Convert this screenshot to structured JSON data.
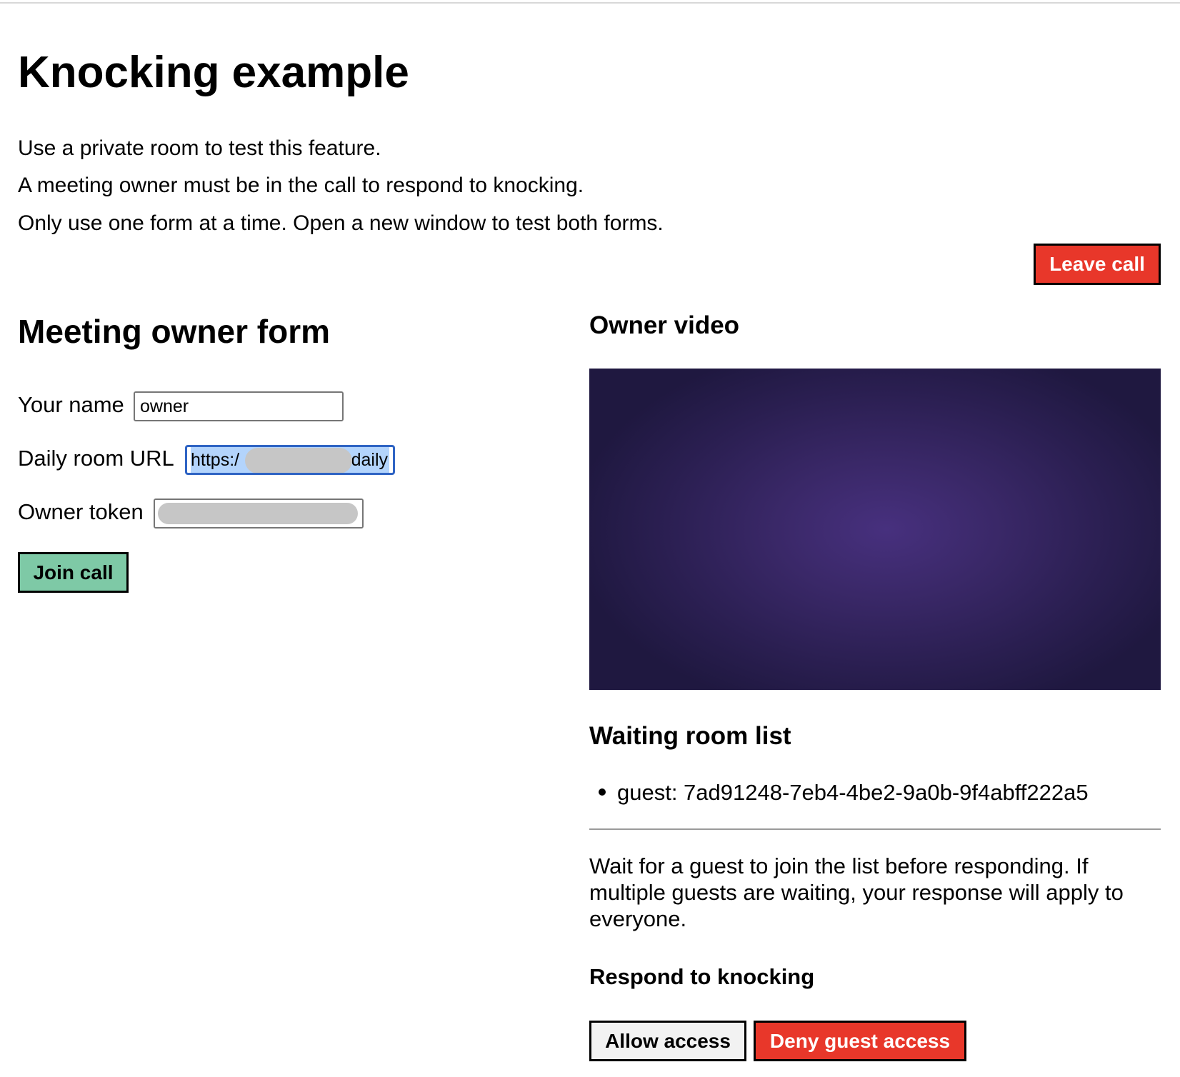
{
  "title": "Knocking example",
  "intro": [
    "Use a private room to test this feature.",
    "A meeting owner must be in the call to respond to knocking.",
    "Only use one form at a time. Open a new window to test both forms."
  ],
  "leave_call_label": "Leave call",
  "owner_form": {
    "heading": "Meeting owner form",
    "name_label": "Your name",
    "name_value": "owner",
    "url_label": "Daily room URL",
    "url_value_start": "https:/",
    "url_value_end": "daily",
    "token_label": "Owner token",
    "join_label": "Join call"
  },
  "owner_video": {
    "heading": "Owner video"
  },
  "waiting_room": {
    "heading": "Waiting room list",
    "items": [
      "guest: 7ad91248-7eb4-4be2-9a0b-9f4abff222a5"
    ]
  },
  "note": "Wait for a guest to join the list before responding. If multiple guests are waiting, your response will apply to everyone.",
  "respond": {
    "heading": "Respond to knocking",
    "allow_label": "Allow access",
    "deny_label": "Deny guest access"
  },
  "colors": {
    "red_button": "#e8372a",
    "green_button": "#7ec9a6",
    "focus_border": "#2f64c4",
    "selection": "#b3d4fc",
    "video_bg": "#2b1f52"
  }
}
